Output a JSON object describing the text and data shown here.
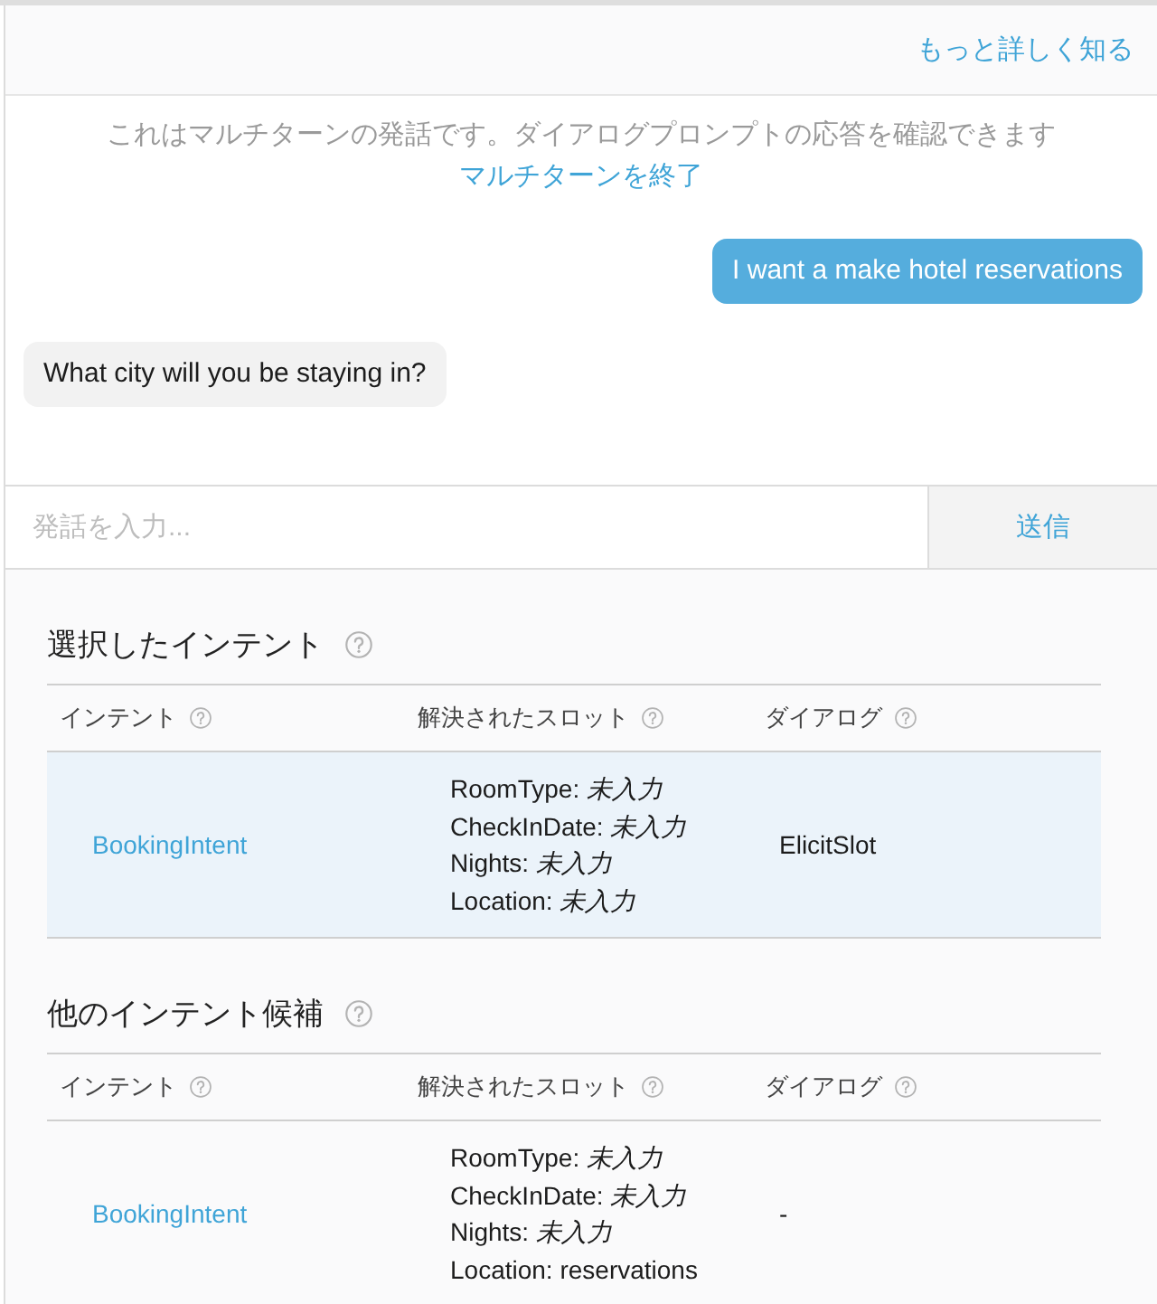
{
  "header": {
    "learn_more_link": "もっと詳しく知る"
  },
  "chat": {
    "notice": "これはマルチターンの発話です。ダイアログプロンプトの応答を確認できます",
    "end_link": "マルチターンを終了",
    "messages": [
      {
        "kind": "user",
        "text": "I want a make hotel reservations"
      },
      {
        "kind": "bot",
        "text": "What city will you be staying in?"
      }
    ]
  },
  "composer": {
    "placeholder": "発話を入力...",
    "send_button": "送信"
  },
  "sections": [
    {
      "title": "選択したインテント",
      "columns": [
        "インテント",
        "解決されたスロット",
        "ダイアログ"
      ],
      "rows": [
        {
          "intent": "BookingIntent",
          "slots": [
            "RoomType: *未入力*",
            "CheckInDate: *未入力*",
            "Nights: *未入力*",
            "Location: *未入力*"
          ],
          "dialog": "ElicitSlot",
          "selected": true
        }
      ]
    },
    {
      "title": "他のインテント候補",
      "columns": [
        "インテント",
        "解決されたスロット",
        "ダイアログ"
      ],
      "rows": [
        {
          "intent": "BookingIntent",
          "slots": [
            "RoomType: *未入力*",
            "CheckInDate: *未入力*",
            "Nights: *未入力*",
            "Location: reservations"
          ],
          "dialog": "-",
          "selected": false
        }
      ]
    }
  ]
}
